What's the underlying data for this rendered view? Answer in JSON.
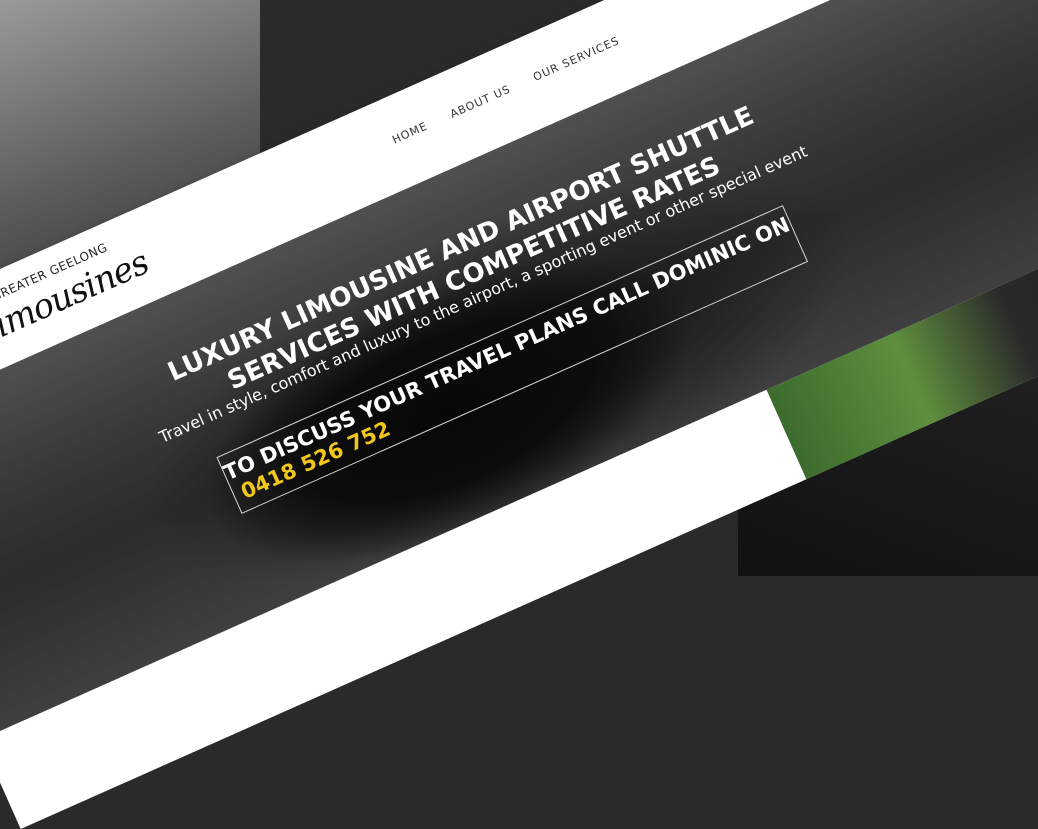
{
  "brand": {
    "top": "GREATER GEELONG",
    "main": "Limousines"
  },
  "nav": {
    "items": [
      "HOME",
      "ABOUT US",
      "OUR SERVICES"
    ]
  },
  "hero": {
    "headline": "LUXURY LIMOUSINE AND AIRPORT SHUTTLE SERVICES WITH COMPETITIVE RATES",
    "subline": "Travel in style, comfort and luxury to the airport, a sporting event or other special event",
    "cta_text": "TO DISCUSS YOUR TRAVEL PLANS CALL DOMINIC ON",
    "cta_phone": "0418 526 752"
  },
  "colors": {
    "accent": "#f2c71c",
    "header_bg": "#ffffff"
  }
}
